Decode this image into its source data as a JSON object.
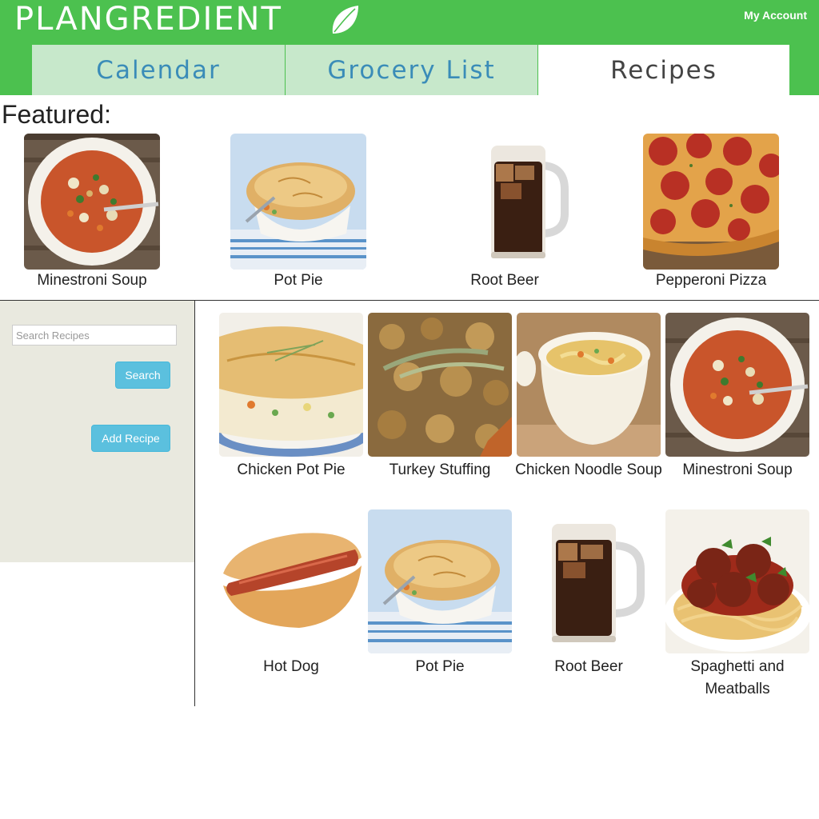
{
  "header": {
    "brand": "Plangredient",
    "account_link": "My Account",
    "tabs": [
      {
        "label": "Calendar",
        "active": false
      },
      {
        "label": "Grocery List",
        "active": false
      },
      {
        "label": "Recipes",
        "active": true
      }
    ]
  },
  "featured": {
    "title": "Featured:",
    "items": [
      {
        "name": "Minestroni Soup",
        "image": "minestrone-soup"
      },
      {
        "name": "Pot Pie",
        "image": "pot-pie"
      },
      {
        "name": "Root Beer",
        "image": "root-beer"
      },
      {
        "name": "Pepperoni Pizza",
        "image": "pepperoni-pizza"
      }
    ]
  },
  "sidebar": {
    "search_placeholder": "Search Recipes",
    "search_value": "",
    "search_button": "Search",
    "add_recipe_button": "Add Recipe"
  },
  "recipes": [
    {
      "name": "Chicken Pot Pie",
      "image": "chicken-pot-pie"
    },
    {
      "name": "Turkey Stuffing",
      "image": "turkey-stuffing"
    },
    {
      "name": "Chicken Noodle Soup",
      "image": "chicken-noodle-soup"
    },
    {
      "name": "Minestroni Soup",
      "image": "minestrone-soup"
    },
    {
      "name": "Hot Dog",
      "image": "hot-dog"
    },
    {
      "name": "Pot Pie",
      "image": "pot-pie"
    },
    {
      "name": "Root Beer",
      "image": "root-beer"
    },
    {
      "name": "Spaghetti and Meatballs",
      "image": "spaghetti-meatballs"
    }
  ],
  "colors": {
    "header_green": "#4cc14f",
    "tab_inactive_bg": "#c7e8cb",
    "tab_inactive_text": "#3a8cb8",
    "sidebar_bg": "#e9e9df",
    "button_blue": "#5bc0de"
  }
}
